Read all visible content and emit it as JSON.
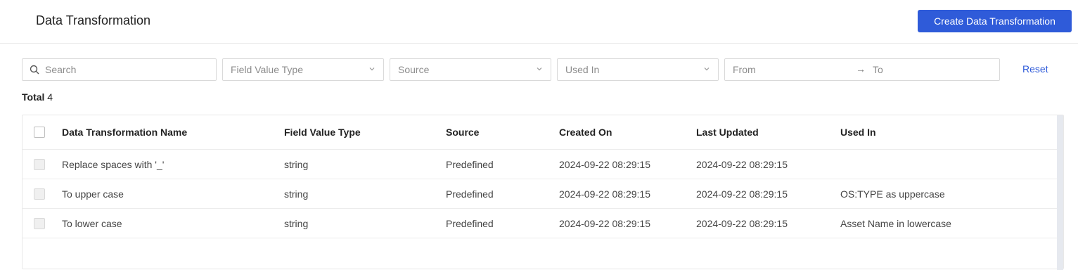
{
  "header": {
    "title": "Data Transformation",
    "create_button": "Create Data Transformation"
  },
  "filters": {
    "search_placeholder": "Search",
    "field_value_type": "Field Value Type",
    "source": "Source",
    "used_in": "Used In",
    "date_from": "From",
    "date_arrow": "→",
    "date_to": "To",
    "reset": "Reset"
  },
  "total": {
    "label": "Total",
    "count": "4"
  },
  "table": {
    "columns": [
      "Data Transformation Name",
      "Field Value Type",
      "Source",
      "Created On",
      "Last Updated",
      "Used In"
    ],
    "rows": [
      [
        "Replace spaces with '_'",
        "string",
        "Predefined",
        "2024-09-22 08:29:15",
        "2024-09-22 08:29:15",
        ""
      ],
      [
        "To upper case",
        "string",
        "Predefined",
        "2024-09-22 08:29:15",
        "2024-09-22 08:29:15",
        "OS:TYPE as uppercase"
      ],
      [
        "To lower case",
        "string",
        "Predefined",
        "2024-09-22 08:29:15",
        "2024-09-22 08:29:15",
        "Asset Name in lowercase"
      ]
    ]
  },
  "colors": {
    "accent": "#2f5bd9",
    "border": "#d9d9d9"
  }
}
